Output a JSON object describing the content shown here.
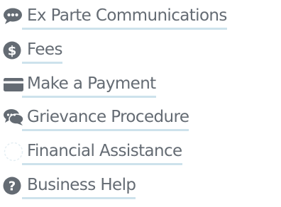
{
  "links": [
    {
      "label": "Ex Parte Communications",
      "icon": "chat-bubble-icon"
    },
    {
      "label": "Fees",
      "icon": "dollar-circle-icon"
    },
    {
      "label": "Make a Payment",
      "icon": "credit-card-icon"
    },
    {
      "label": "Grievance Procedure",
      "icon": "comments-icon"
    },
    {
      "label": "Financial Assistance",
      "icon": "dashed-circle-icon"
    },
    {
      "label": "Business Help",
      "icon": "question-circle-icon"
    }
  ],
  "colors": {
    "icon": "#646b73",
    "text": "#646b73",
    "underline": "#cde2ec",
    "faint_icon": "#e4eef3"
  }
}
